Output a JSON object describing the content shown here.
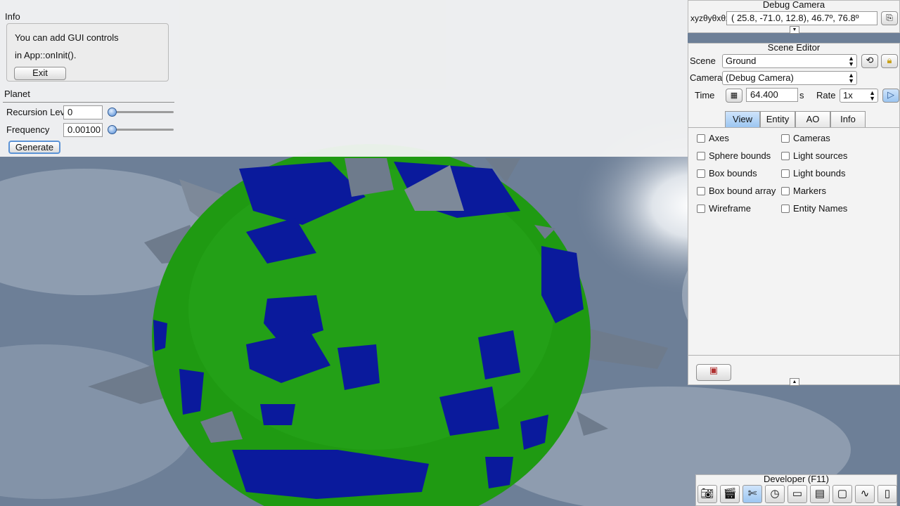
{
  "info_panel": {
    "title": "Info",
    "text_line1": "You can add GUI controls",
    "text_line2": "in App::onInit().",
    "exit_label": "Exit"
  },
  "planet_panel": {
    "title": "Planet",
    "recursion_label": "Recursion Level",
    "recursion_value": "0",
    "recursion_slider": 0.0,
    "frequency_label": "Frequency",
    "frequency_value": "0.00100",
    "frequency_slider": 0.0,
    "generate_label": "Generate"
  },
  "debug_camera": {
    "title": "Debug Camera",
    "xyz_label": "xyzθyθxθz",
    "coords": "( 25.8, -71.0,  12.8),  46.7º,  76.8º",
    "expand_icon": "down-arrow-icon"
  },
  "scene_editor": {
    "title": "Scene Editor",
    "scene_label": "Scene",
    "scene_value": "Ground",
    "camera_label": "Camera",
    "camera_value": "(Debug Camera)",
    "time_label": "Time",
    "time_value": "64.400",
    "time_unit": "s",
    "rate_label": "Rate",
    "rate_value": "1x",
    "tabs": [
      {
        "label": "View",
        "active": true
      },
      {
        "label": "Entity",
        "active": false
      },
      {
        "label": "AO",
        "active": false
      },
      {
        "label": "Info",
        "active": false
      }
    ],
    "checkboxes_left": [
      "Axes",
      "Sphere bounds",
      "Box bounds",
      "Box bound array",
      "Wireframe"
    ],
    "checkboxes_right": [
      "Cameras",
      "Light sources",
      "Light bounds",
      "Markers",
      "Entity Names"
    ]
  },
  "developer": {
    "title": "Developer (F11)",
    "buttons": [
      "camera-icon",
      "clapperboard-icon",
      "tools-icon",
      "clock-icon",
      "note-icon",
      "terminal-icon",
      "windows-icon",
      "stats-icon",
      "document-icon"
    ]
  },
  "colors": {
    "planet_green": "#1f9a12",
    "water_blue": "#0a1a9c",
    "rock_gray": "#6e7b8c",
    "sky": "#6f8096",
    "accent": "#4d87d3"
  }
}
